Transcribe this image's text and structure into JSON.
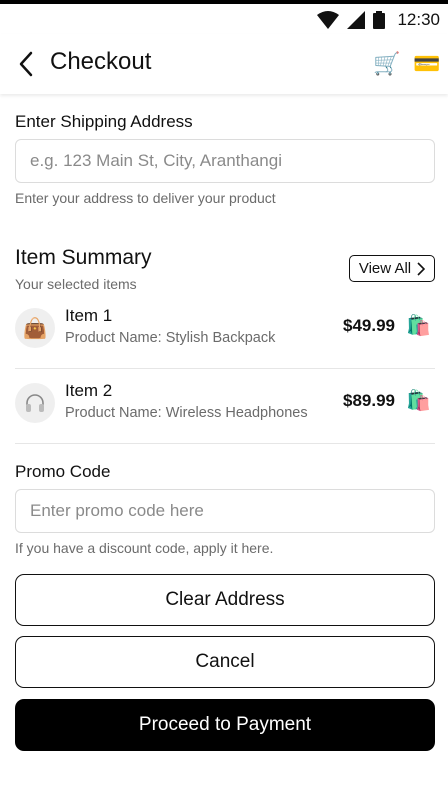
{
  "status_bar": {
    "time": "12:30"
  },
  "app_bar": {
    "title": "Checkout",
    "icons": [
      "back-arrow-icon",
      "shopping-cart-icon",
      "credit-card-icon"
    ]
  },
  "shipping": {
    "label": "Enter Shipping Address",
    "placeholder": "e.g. 123 Main St, City, Aranthangi",
    "value": "",
    "helper": "Enter your address to deliver your product"
  },
  "summary": {
    "title": "Item Summary",
    "subtitle": "Your selected items",
    "view_all": "View All",
    "items": [
      {
        "name": "Item 1",
        "description": "Product Name: Stylish Backpack",
        "price": "$49.99",
        "icon": "handbag-icon"
      },
      {
        "name": "Item 2",
        "description": "Product Name: Wireless Headphones",
        "price": "$89.99",
        "icon": "headphones-icon"
      }
    ]
  },
  "promo": {
    "label": "Promo Code",
    "placeholder": "Enter promo code here",
    "value": "",
    "helper": "If you have a discount code, apply it here."
  },
  "actions": {
    "clear": "Clear Address",
    "cancel": "Cancel",
    "proceed": "Proceed to Payment"
  },
  "colors": {
    "primary": "#000000",
    "muted": "#6b6b6b",
    "border": "#dcdcdc"
  }
}
